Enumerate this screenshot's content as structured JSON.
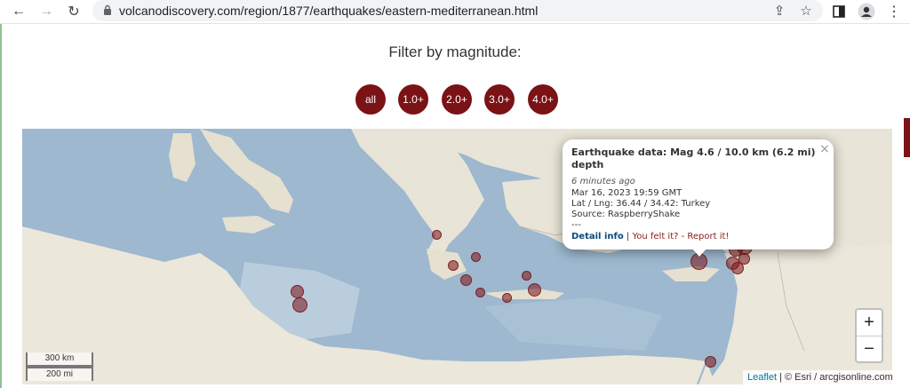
{
  "browser": {
    "url": "volcanodiscovery.com/region/1877/earthquakes/eastern-mediterranean.html"
  },
  "filter": {
    "title": "Filter by magnitude:",
    "buttons": [
      "all",
      "1.0+",
      "2.0+",
      "3.0+",
      "4.0+"
    ]
  },
  "popup": {
    "title": "Earthquake data: Mag 4.6 / 10.0 km (6.2 mi) depth",
    "time_ago": "6 minutes ago",
    "datetime": "Mar 16, 2023 19:59 GMT",
    "location": "Lat / Lng: 36.44 / 34.42: Turkey",
    "source": "Source: RaspberryShake",
    "separator": "---",
    "detail_link": "Detail info",
    "divider": "|",
    "felt_link": "You felt it? - Report it!",
    "close": "×"
  },
  "map": {
    "zoom_in": "+",
    "zoom_out": "−",
    "scale_km": "300 km",
    "scale_mi": "200 mi",
    "attribution_link": "Leaflet",
    "attribution_text": "| © Esri / arcgisonline.com",
    "colors": {
      "marker": "#7a1216",
      "sea": "#9db8cf",
      "land": "#e7e3d6"
    }
  }
}
